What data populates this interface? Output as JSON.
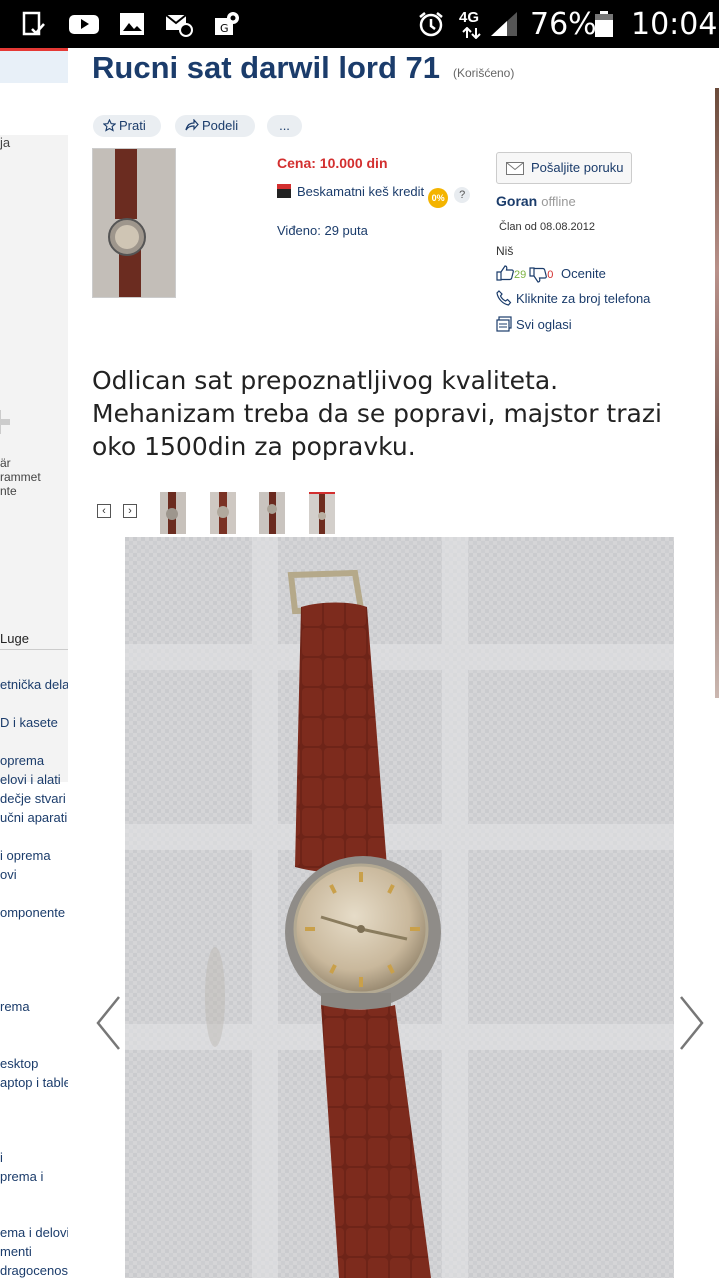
{
  "status_bar": {
    "signal_label": "4G",
    "battery": "76%",
    "time": "10:04",
    "icons": [
      "notification-check-icon",
      "youtube-icon",
      "gallery-icon",
      "email-icon",
      "location-icon",
      "alarm-icon",
      "signal-icon",
      "battery-icon"
    ]
  },
  "left_nav": {
    "top_fragment": "ja",
    "ad_lines": [
      "är",
      "rammet",
      "nte"
    ],
    "section_heading": "Luge",
    "items": [
      "etnička dela",
      "D i kasete",
      "oprema",
      "elovi i alati",
      "dečje stvari",
      "učni aparati",
      "i oprema",
      "ovi",
      "omponente",
      "rema",
      "esktop",
      "aptop i tablet",
      "i",
      "prema i",
      "ema i delovi",
      "menti",
      "dragocenosti"
    ]
  },
  "listing": {
    "title": "Rucni sat darwil lord 71",
    "condition": "(Korišćeno)",
    "actions": {
      "follow": "Prati",
      "share": "Podeli",
      "more": "..."
    },
    "price": "Cena: 10.000 din",
    "credit_label": "Beskamatni keš kredit",
    "credit_badge": "0%",
    "help": "?",
    "views": "Viđeno: 29 puta",
    "description": "Odlican sat prepoznatljivog kvaliteta. Mehanizam treba da se popravi, majstor trazi oko 1500din za popravku."
  },
  "seller": {
    "message_button": "Pošaljite poruku",
    "name": "Goran",
    "status": "offline",
    "member_since": "Član od 08.08.2012",
    "city": "Niš",
    "likes": "29",
    "dislikes": "0",
    "rate_label": "Ocenite",
    "phone_label": "Kliknite za broj telefona",
    "all_ads_label": "Svi oglasi"
  },
  "gallery": {
    "thumbnail_count": 4,
    "active_index": 4
  },
  "colors": {
    "brand_blue": "#1b3c6b",
    "price_red": "#d32f2f",
    "badge_yellow": "#f4b400"
  }
}
